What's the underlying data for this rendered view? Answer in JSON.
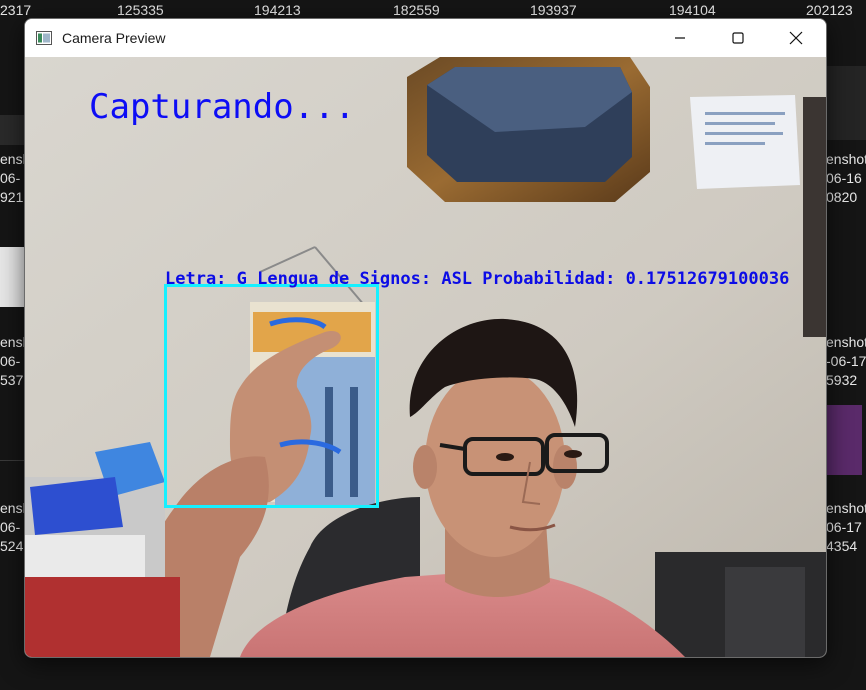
{
  "background": {
    "top_numbers": [
      "2317",
      "125335",
      "194213",
      "182559",
      "193937",
      "194104",
      "202123"
    ],
    "left_labels": [
      [
        "enshi",
        "06-",
        "921"
      ],
      [
        "enshi",
        "06-",
        "537"
      ],
      [
        "enshi",
        "06-",
        "524"
      ]
    ],
    "right_labels": [
      [
        "enshot",
        "06-16",
        "0820"
      ],
      [
        "enshot",
        "-06-17",
        "5932"
      ],
      [
        "enshot",
        "06-17",
        "4354"
      ]
    ]
  },
  "window": {
    "title": "Camera Preview",
    "controls": [
      "minimize",
      "maximize",
      "close"
    ]
  },
  "camera": {
    "status_text": "Capturando...",
    "prediction_text": "Letra: G  Lengua de Signos: ASL Probabilidad: 0.17512679100036",
    "roi_color": "#16f0ff",
    "overlay_color": "#0d0df5"
  }
}
